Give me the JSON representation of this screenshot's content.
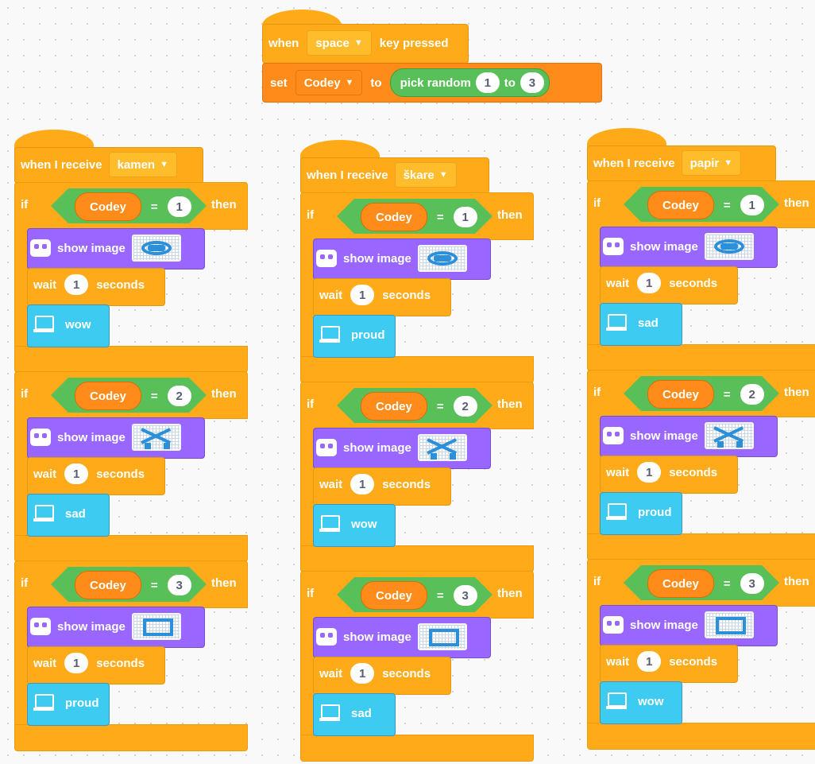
{
  "top": {
    "when": "when",
    "key": "space",
    "key_pressed": "key pressed",
    "set": "set",
    "variable": "Codey",
    "to": "to",
    "pick_random": "pick random",
    "from": "1",
    "to_value": "3"
  },
  "labels": {
    "when_i_receive": "when I receive",
    "if": "if",
    "then": "then",
    "codey": "Codey",
    "equals": "=",
    "show_image": "show image",
    "wait": "wait",
    "seconds": "seconds"
  },
  "scripts": [
    {
      "message": "kamen",
      "cases": [
        {
          "value": "1",
          "image": "rock",
          "wait": "1",
          "emotion": "wow"
        },
        {
          "value": "2",
          "image": "scissors",
          "wait": "1",
          "emotion": "sad"
        },
        {
          "value": "3",
          "image": "paper",
          "wait": "1",
          "emotion": "proud"
        }
      ]
    },
    {
      "message": "škare",
      "cases": [
        {
          "value": "1",
          "image": "rock",
          "wait": "1",
          "emotion": "proud"
        },
        {
          "value": "2",
          "image": "scissors",
          "wait": "1",
          "emotion": "wow"
        },
        {
          "value": "3",
          "image": "paper",
          "wait": "1",
          "emotion": "sad"
        }
      ]
    },
    {
      "message": "papir",
      "cases": [
        {
          "value": "1",
          "image": "rock",
          "wait": "1",
          "emotion": "sad"
        },
        {
          "value": "2",
          "image": "scissors",
          "wait": "1",
          "emotion": "proud"
        },
        {
          "value": "3",
          "image": "paper",
          "wait": "1",
          "emotion": "wow"
        }
      ]
    }
  ],
  "colors": {
    "events": "#ffab19",
    "variables": "#ff8c1a",
    "operators": "#59c059",
    "looks": "#9966ff",
    "emotion": "#3ecbf2"
  }
}
